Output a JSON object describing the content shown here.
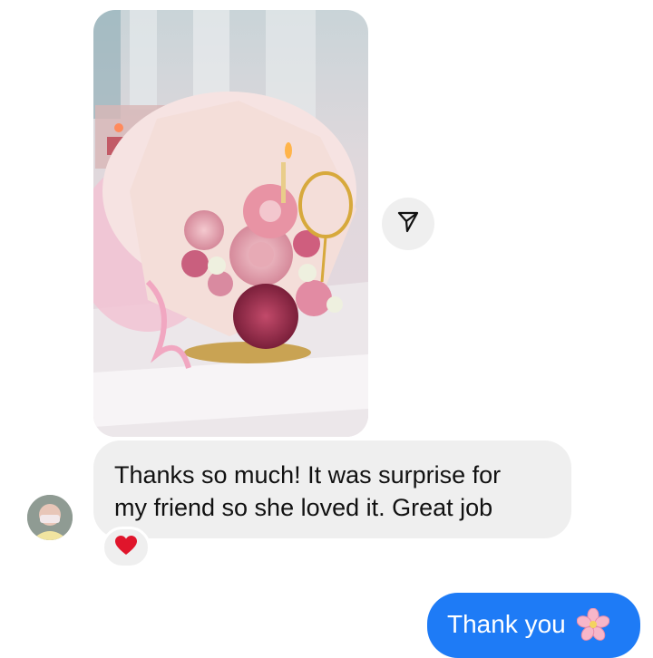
{
  "conversation": {
    "photo_icon": "bouquet-photo",
    "share_icon": "share-send-icon",
    "incoming_message": {
      "line1": "Thanks so much! It was surprise for",
      "line2": "my friend so she loved it. Great job",
      "reaction_icon": "red-heart"
    },
    "outgoing_message": {
      "text": "Thank you",
      "emoji_icon": "cherry-blossom"
    },
    "colors": {
      "incoming_bubble": "#efefef",
      "outgoing_bubble": "#1e7bf6",
      "reaction_heart": "#e0152b"
    }
  }
}
